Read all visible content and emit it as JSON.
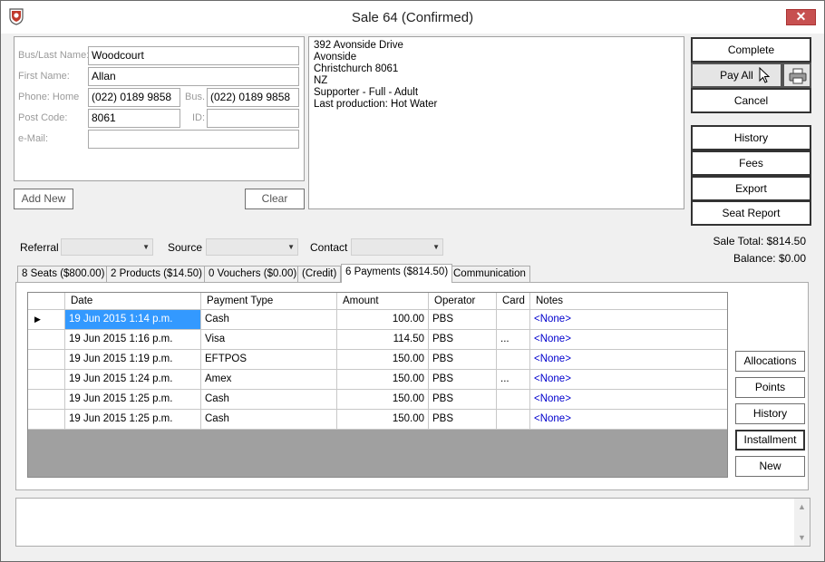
{
  "window": {
    "title": "Sale 64 (Confirmed)",
    "close_label": "✕"
  },
  "customer": {
    "bus_last_name_label": "Bus/Last Name:",
    "bus_last_name": "Woodcourt",
    "first_name_label": "First Name:",
    "first_name": "Allan",
    "phone_home_label": "Phone: Home",
    "phone_home": "(022) 0189 9858",
    "bus_label": "Bus.",
    "phone_bus": "(022) 0189 9858",
    "post_code_label": "Post Code:",
    "post_code": "8061",
    "id_label": "ID:",
    "id": "",
    "email_label": "e-Mail:",
    "email": "",
    "add_new_label": "Add New",
    "clear_label": "Clear"
  },
  "address_lines": [
    "392 Avonside Drive",
    "Avonside",
    "Christchurch 8061",
    "NZ",
    "Supporter - Full - Adult",
    "Last production: Hot Water"
  ],
  "actions": {
    "complete": "Complete",
    "pay_all": "Pay All",
    "cancel": "Cancel",
    "history": "History",
    "fees": "Fees",
    "export": "Export",
    "seat_report": "Seat Report"
  },
  "totals": {
    "sale_total": "Sale Total: $814.50",
    "balance": "Balance: $0.00"
  },
  "filters": {
    "referral_label": "Referral",
    "referral_value": "",
    "source_label": "Source",
    "source_value": "",
    "contact_label": "Contact",
    "contact_value": ""
  },
  "tabs": [
    {
      "label": "8 Seats ($800.00)"
    },
    {
      "label": "2 Products ($14.50)"
    },
    {
      "label": "0 Vouchers ($0.00)"
    },
    {
      "label": "(Credit)"
    },
    {
      "label": "6 Payments ($814.50)"
    },
    {
      "label": "Communication"
    }
  ],
  "payments": {
    "columns": [
      "Date",
      "Payment Type",
      "Amount",
      "Operator",
      "Card",
      "Notes"
    ],
    "rows": [
      {
        "date": "19 Jun 2015 1:14 p.m.",
        "type": "Cash",
        "amount": "100.00",
        "operator": "PBS",
        "card": "",
        "notes": "<None>"
      },
      {
        "date": "19 Jun 2015 1:16 p.m.",
        "type": "Visa",
        "amount": "114.50",
        "operator": "PBS",
        "card": "...",
        "notes": "<None>"
      },
      {
        "date": "19 Jun 2015 1:19 p.m.",
        "type": "EFTPOS",
        "amount": "150.00",
        "operator": "PBS",
        "card": "",
        "notes": "<None>"
      },
      {
        "date": "19 Jun 2015 1:24 p.m.",
        "type": "Amex",
        "amount": "150.00",
        "operator": "PBS",
        "card": "...",
        "notes": "<None>"
      },
      {
        "date": "19 Jun 2015 1:25 p.m.",
        "type": "Cash",
        "amount": "150.00",
        "operator": "PBS",
        "card": "",
        "notes": "<None>"
      },
      {
        "date": "19 Jun 2015 1:25 p.m.",
        "type": "Cash",
        "amount": "150.00",
        "operator": "PBS",
        "card": "",
        "notes": "<None>"
      }
    ],
    "buttons": {
      "allocations": "Allocations",
      "points": "Points",
      "history": "History",
      "installment": "Installment",
      "new": "New"
    }
  },
  "notes_text": "",
  "colors": {
    "selection": "#3399ff",
    "link": "#0000cc",
    "close": "#c75050"
  },
  "icons": [
    "app-logo-icon",
    "close-icon",
    "printer-icon",
    "row-pointer-icon",
    "dropdown-arrow-icon",
    "scroll-up-icon",
    "scroll-down-icon",
    "mouse-cursor-icon"
  ]
}
